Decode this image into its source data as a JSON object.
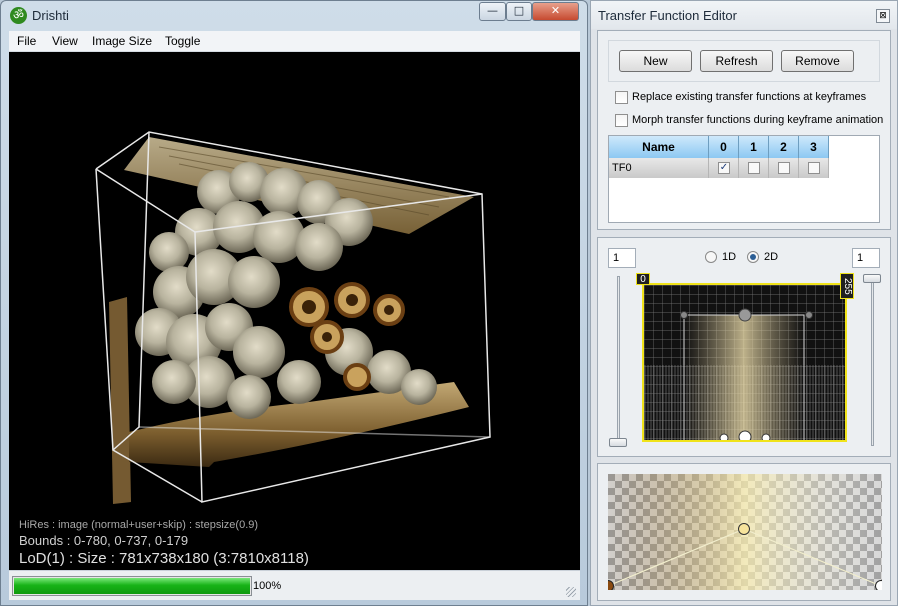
{
  "main_window": {
    "title": "Drishti",
    "icon": "om-icon",
    "icon_glyph": "ॐ",
    "caption_buttons": {
      "minimize": "—",
      "maximize": "□",
      "close": "✕"
    },
    "menu": [
      "File",
      "View",
      "Image Size",
      "Toggle"
    ],
    "viewport": {
      "hires_text": "HiRes : image (normal+user+skip) : stepsize(0.9)",
      "bounds_text": "Bounds : 0-780, 0-737, 0-179",
      "lod_text": "LoD(1) : Size : 781x738x180 (3:7810x8118)"
    },
    "status": {
      "progress": 100,
      "progress_label": "100%"
    }
  },
  "tf_editor": {
    "title": "Transfer Function Editor",
    "close_glyph": "⊠",
    "buttons": {
      "new": "New",
      "refresh": "Refresh",
      "remove": "Remove"
    },
    "options": {
      "replace_label": "Replace existing transfer functions at keyframes",
      "replace_checked": false,
      "morph_label": "Morph transfer functions during keyframe animation",
      "morph_checked": false
    },
    "table": {
      "headers": [
        "Name",
        "0",
        "1",
        "2",
        "3"
      ],
      "rows": [
        {
          "name": "TF0",
          "checks": [
            true,
            false,
            false,
            false
          ]
        }
      ]
    },
    "editor": {
      "spin_left": "1",
      "spin_right": "1",
      "mode_1d": "1D",
      "mode_2d": "2D",
      "selected_mode": "2D",
      "tag_min": "0",
      "tag_max": "255",
      "check_glyph": "✓"
    },
    "colors": {
      "accent_yellow": "#f0e31a",
      "progress_green": "#18b318",
      "header_blue": "#8cc8f2",
      "volume_beige": "#c9b98f"
    }
  }
}
